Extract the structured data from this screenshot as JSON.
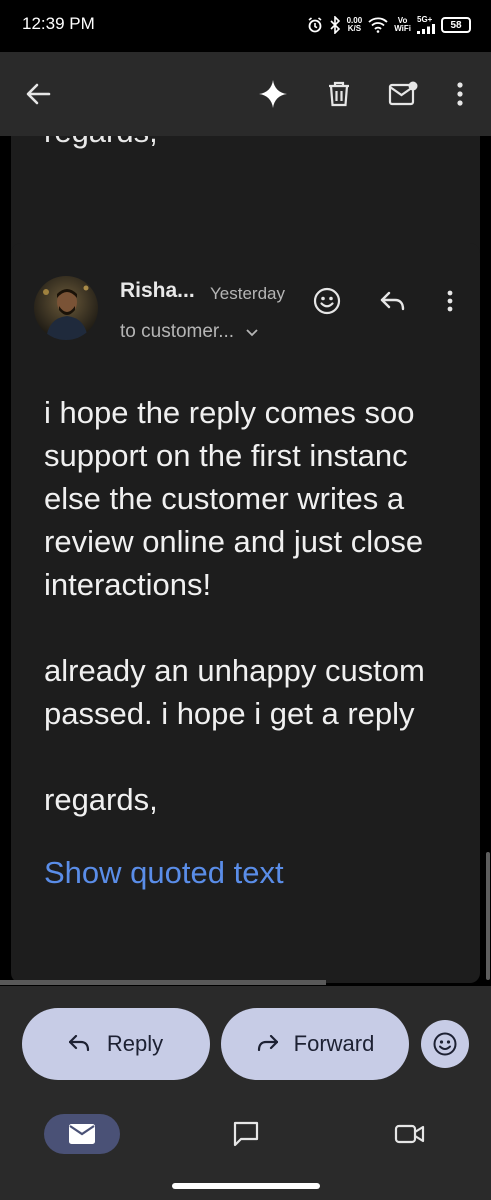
{
  "status_bar": {
    "time": "12:39 PM",
    "net_speed_value": "0.00",
    "net_speed_unit": "K/S",
    "vowifi_top": "Vo",
    "vowifi_bottom": "WiFi",
    "network": "5G+",
    "battery": "58"
  },
  "app_bar": {
    "back_icon": "arrow-left-icon",
    "actions": [
      "sparkle-icon",
      "trash-icon",
      "mark-unread-icon",
      "more-vert-icon"
    ]
  },
  "previous_message": {
    "partial_text": "regards,"
  },
  "message": {
    "sender": "Risha...",
    "time": "Yesterday",
    "to_line": "to customer...",
    "body_lines": [
      "i hope the reply comes soo",
      "support on the first instanc",
      "else the customer writes a",
      "review online and just close",
      "interactions!",
      "",
      "already an unhappy custom",
      "passed. i hope i get a reply",
      "",
      "regards,"
    ],
    "show_quoted": "Show quoted text"
  },
  "actions": {
    "reply_label": "Reply",
    "forward_label": "Forward"
  },
  "bottom_nav": {
    "items": [
      "mail-icon",
      "chat-icon",
      "meet-icon"
    ],
    "active": "mail-icon"
  },
  "colors": {
    "app_bar": "#2a2a2a",
    "card": "#1d1d1d",
    "link": "#5a8de8",
    "pill": "#c7cce6",
    "nav_active": "#4a5176"
  }
}
